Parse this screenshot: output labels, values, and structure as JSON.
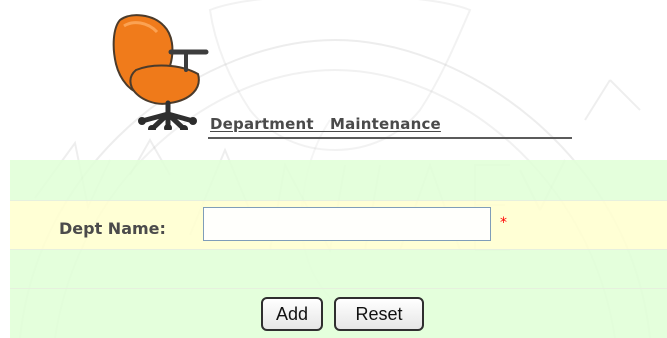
{
  "header": {
    "title": "Department   Maintenance",
    "icon": "office-chair-icon"
  },
  "form": {
    "dept_name_label": "Dept Name:",
    "dept_name_value": "",
    "dept_name_placeholder": "",
    "required_marker": "*"
  },
  "buttons": {
    "add_label": "Add",
    "reset_label": "Reset"
  },
  "colors": {
    "row_green": "#dfffd6",
    "row_yellow": "#ffffce",
    "required": "#ff0000",
    "text": "#4b4b4b"
  }
}
